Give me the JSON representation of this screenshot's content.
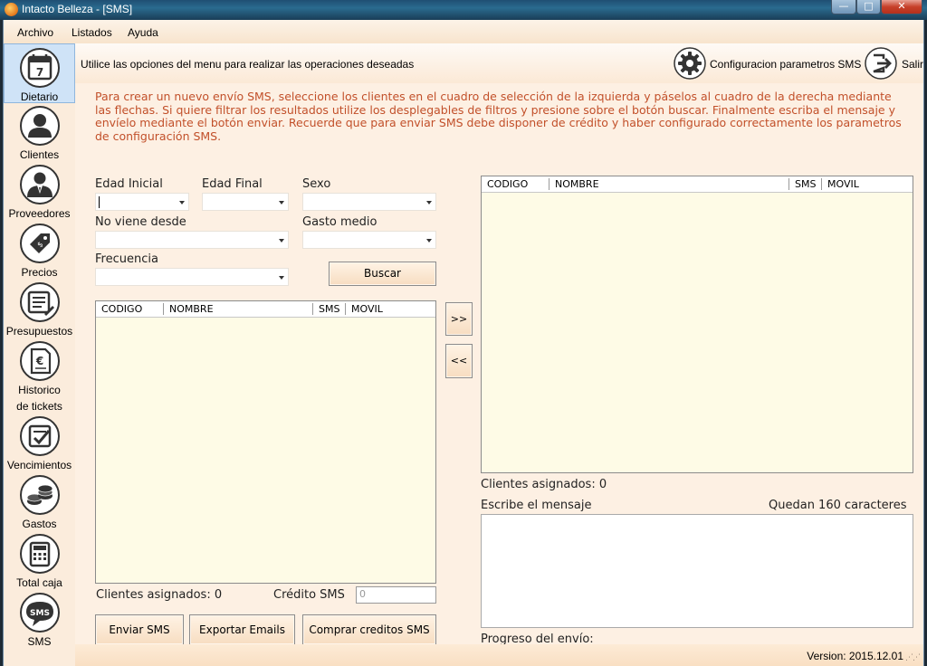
{
  "window": {
    "title": "Intacto Belleza - [SMS]",
    "minimize": "—",
    "maximize": "□",
    "close": "✕"
  },
  "menu": [
    "Archivo",
    "Listados",
    "Ayuda"
  ],
  "sidebar": [
    {
      "label": "Dietario",
      "icon": "calendar-icon",
      "day": "7"
    },
    {
      "label": "Clientes",
      "icon": "user-icon"
    },
    {
      "label": "Proveedores",
      "icon": "supplier-icon"
    },
    {
      "label": "Precios",
      "icon": "price-tag-icon"
    },
    {
      "label": "Presupuestos",
      "icon": "budget-icon"
    },
    {
      "label": "Historico",
      "label2": "de tickets",
      "icon": "ticket-history-icon"
    },
    {
      "label": "Vencimientos",
      "icon": "expiry-icon"
    },
    {
      "label": "Gastos",
      "icon": "coins-icon"
    },
    {
      "label": "Total caja",
      "icon": "calculator-icon"
    },
    {
      "label": "SMS",
      "icon": "sms-icon",
      "badge": "SMS"
    }
  ],
  "header": {
    "hint": "Utilice las opciones del menu para realizar las operaciones deseadas",
    "config_label": "Configuracion parametros SMS",
    "exit_label": "Salir"
  },
  "instructions": "Para crear un nuevo envío SMS, seleccione los clientes en el cuadro de selección de la izquierda y páselos al cuadro de la derecha mediante las flechas. Si quiere filtrar los resultados utilize los desplegables de filtros y presione sobre el botón buscar. Finalmente escriba el mensaje y envíelo mediante el botón enviar. Recuerde que para enviar SMS debe disponer de crédito y haber configurado correctamente los parametros de configuración SMS.",
  "filters": {
    "edad_inicial": "Edad Inicial",
    "edad_final": "Edad Final",
    "sexo": "Sexo",
    "no_viene_desde": "No viene desde",
    "gasto_medio": "Gasto medio",
    "frecuencia": "Frecuencia",
    "buscar": "Buscar"
  },
  "grid_columns": [
    "CODIGO",
    "NOMBRE",
    "SMS",
    "MOVIL"
  ],
  "transfer": {
    "add": ">>",
    "remove": "<<"
  },
  "left_footer": {
    "asignados": "Clientes asignados: 0",
    "credito_label": "Crédito SMS",
    "credito_value": "0"
  },
  "right_footer": {
    "asignados": "Clientes asignados: 0",
    "mensaje_label": "Escribe el mensaje",
    "quedan": "Quedan 160 caracteres",
    "progreso": "Progreso del envío:"
  },
  "actions": {
    "enviar": "Enviar SMS",
    "exportar": "Exportar Emails",
    "comprar": "Comprar creditos SMS"
  },
  "status": {
    "version": "Version: 2015.12.01"
  }
}
